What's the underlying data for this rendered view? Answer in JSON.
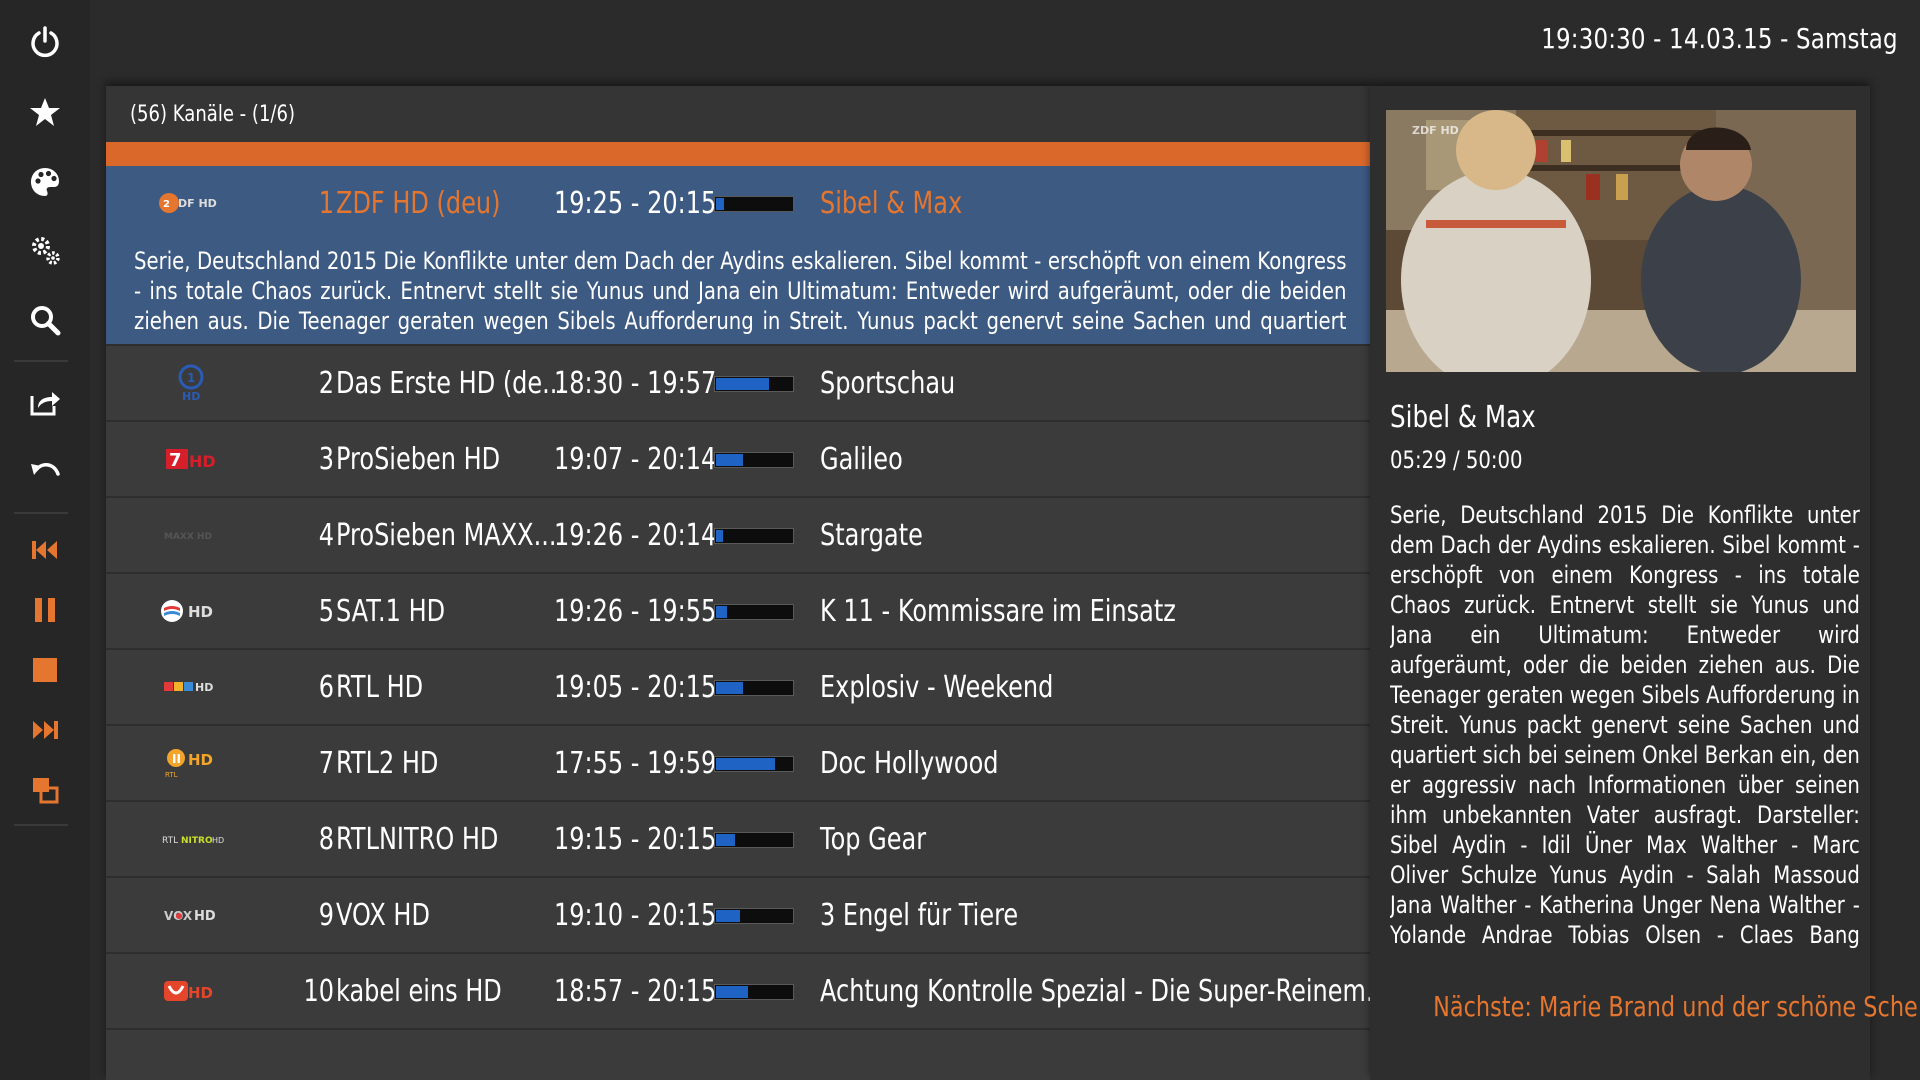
{
  "clock": "19:30:30 - 14.03.15 - Samstag",
  "header": {
    "text": "(56) Kanäle -  (1/6)"
  },
  "colors": {
    "accent": "#e5762f",
    "selected_row": "#3d5a82",
    "progress_fill": "#1f63c4"
  },
  "sidebar": {
    "items": [
      {
        "icon": "power-icon"
      },
      {
        "icon": "star-icon"
      },
      {
        "icon": "palette-icon"
      },
      {
        "icon": "settings-icon"
      },
      {
        "icon": "search-icon"
      },
      {
        "icon": "export-icon"
      },
      {
        "icon": "back-icon"
      },
      {
        "icon": "skip-previous-icon"
      },
      {
        "icon": "pause-icon"
      },
      {
        "icon": "stop-icon"
      },
      {
        "icon": "skip-next-icon"
      },
      {
        "icon": "pip-icon"
      }
    ]
  },
  "channels": [
    {
      "num": "1",
      "name": "ZDF HD (deu)",
      "time": "19:25 - 20:15",
      "progress": 0.1,
      "program": "Sibel & Max",
      "logo": "ZDF HD",
      "selected": true,
      "description": "Serie, Deutschland 2015 Die Konflikte unter dem Dach der Aydins eskalieren. Sibel kommt - erschöpft von einem Kongress - ins totale Chaos zurück. Entnervt stellt sie Yunus und Jana ein Ultimatum: Entweder wird aufgeräumt, oder die beiden ziehen aus. Die Teenager geraten wegen Sibels Aufforderung in Streit. Yunus packt genervt seine Sachen und quartiert sich bei seinem Onkel"
    },
    {
      "num": "2",
      "name": "Das Erste HD (de...",
      "time": "18:30 - 19:57",
      "progress": 0.7,
      "program": "Sportschau",
      "logo": "Das Erste HD"
    },
    {
      "num": "3",
      "name": "ProSieben HD",
      "time": "19:07 - 20:14",
      "progress": 0.35,
      "program": "Galileo",
      "logo": "ProSieben HD"
    },
    {
      "num": "4",
      "name": "ProSieben MAXX...",
      "time": "19:26 - 20:14",
      "progress": 0.09,
      "program": "Stargate",
      "logo": "ProSieben MAXX HD"
    },
    {
      "num": "5",
      "name": "SAT.1 HD",
      "time": "19:26 - 19:55",
      "progress": 0.15,
      "program": "K 11 - Kommissare im Einsatz",
      "logo": "SAT.1 HD"
    },
    {
      "num": "6",
      "name": "RTL HD",
      "time": "19:05 - 20:15",
      "progress": 0.36,
      "program": "Explosiv - Weekend",
      "logo": "RTL HD"
    },
    {
      "num": "7",
      "name": "RTL2 HD",
      "time": "17:55 - 19:59",
      "progress": 0.77,
      "program": "Doc Hollywood",
      "logo": "RTL2 HD"
    },
    {
      "num": "8",
      "name": "RTLNITRO HD",
      "time": "19:15 - 20:15",
      "progress": 0.25,
      "program": "Top Gear",
      "logo": "RTLNITRO HD"
    },
    {
      "num": "9",
      "name": "VOX HD",
      "time": "19:10 - 20:15",
      "progress": 0.31,
      "program": "3 Engel für Tiere",
      "logo": "VOX HD"
    },
    {
      "num": "10",
      "name": "kabel eins HD",
      "time": "18:57 - 20:15",
      "progress": 0.42,
      "program": "Achtung Kontrolle Spezial - Die Super-Reinem...",
      "logo": "kabel eins HD"
    }
  ],
  "detail": {
    "title": "Sibel & Max",
    "time": "05:29 / 50:00",
    "preview_logo": "ZDF HD",
    "description": "Serie, Deutschland 2015 Die Konflikte unter dem Dach der Aydins eskalieren. Sibel kommt - erschöpft von einem Kongress - ins totale Chaos zurück. Entnervt stellt sie Yunus und Jana ein Ultimatum: Entweder wird aufgeräumt, oder die beiden ziehen aus. Die Teenager geraten wegen Sibels Aufforderung in Streit. Yunus packt genervt seine Sachen und quartiert sich bei seinem Onkel Berkan ein, den er aggressiv nach Informationen über seinen ihm unbekannten Vater ausfragt. Darsteller: Sibel Aydin - Idil Üner Max Walther - Marc Oliver Schulze Yunus Aydin - Salah Massoud Jana Walther - Katherina Unger Nena Walther - Yolande Andrae Tobias Olsen - Claes Bang Paula Hansen - Nina Petri u.a. Regie:",
    "next": "Nächste: Marie Brand und der schöne Schein"
  }
}
